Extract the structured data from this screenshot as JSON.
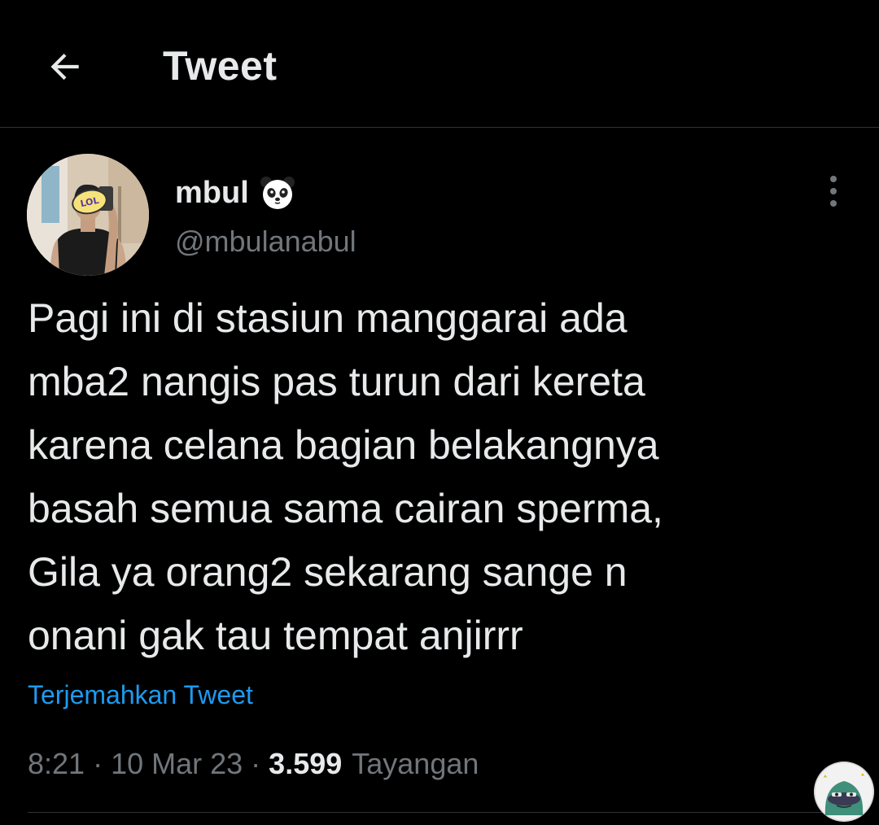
{
  "header": {
    "back_icon": "arrow-left-icon",
    "title": "Tweet"
  },
  "author": {
    "name": "mbul",
    "emoji_icon": "panda-face-icon",
    "handle": "@mbulanabul",
    "avatar_sticker_text": "LOL"
  },
  "tweet": {
    "text": "Pagi ini di stasiun manggarai ada\nmba2 nangis pas turun dari kereta\nkarena celana bagian belakangnya\nbasah semua sama cairan sperma,\nGila ya orang2 sekarang sange n\nonani gak tau tempat anjirrr",
    "translate_label": "Terjemahkan Tweet"
  },
  "meta": {
    "time": "8:21",
    "separator": "·",
    "date": "10 Mar 23",
    "views_count": "3.599",
    "views_label": "Tayangan"
  },
  "colors": {
    "background": "#000000",
    "text_primary": "#e7e9ea",
    "text_secondary": "#71767b",
    "link": "#1d9bf0",
    "divider": "#2f3336"
  },
  "icons": {
    "more": "more-vertical-icon",
    "watermark": "frog-sticker-icon"
  }
}
